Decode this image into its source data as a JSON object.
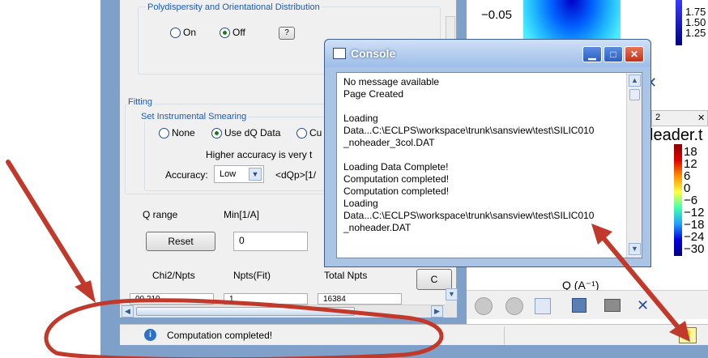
{
  "polydispersity": {
    "title": "Polydispersity and Orientational Distribution",
    "on_label": "On",
    "off_label": "Off",
    "help_label": "?"
  },
  "fitting": {
    "title": "Fitting",
    "smearing_title": "Set Instrumental Smearing",
    "options": [
      "None",
      "Use dQ Data",
      "Cu"
    ],
    "selected": "Use dQ Data",
    "accuracy_note": "Higher accuracy is very t",
    "accuracy_label": "Accuracy:",
    "accuracy_value": "Low",
    "dqp_label": "<dQp>[1/"
  },
  "qrange": {
    "label": "Q range",
    "min_header": "Min[1/A]",
    "reset_label": "Reset",
    "min_value": "0"
  },
  "stats": {
    "chi2_label": "Chi2/Npts",
    "npts_fit_label": "Npts(Fit)",
    "total_npts_label": "Total Npts",
    "chi2_value": "00.210",
    "npts_fit_value": "1",
    "total_npts_value": "16384",
    "cut_button_label": "C"
  },
  "plot": {
    "top_tick": "−0.05",
    "colorbar_top": [
      "1.75",
      "1.50",
      "1.25"
    ],
    "tab_fragment": "2",
    "title_fragment": "leader.t",
    "colorbar_bottom": [
      "18",
      "12",
      "6",
      "0",
      "−6",
      "−12",
      "−18",
      "−24",
      "−30"
    ],
    "xaxis_label": "Q (A⁻¹)"
  },
  "console": {
    "title": "Console",
    "lines": [
      "No message available",
      "Page Created",
      "",
      "Loading",
      "Data...C:\\ECLPS\\workspace\\trunk\\sansview\\test\\SILIC010",
      "_noheader_3col.DAT",
      "",
      "Loading Data Complete!",
      "Computation  completed!",
      "Computation  completed!",
      "Loading",
      "Data...C:\\ECLPS\\workspace\\trunk\\sansview\\test\\SILIC010",
      "_noheader.DAT"
    ]
  },
  "statusbar": {
    "message": "Computation  completed!"
  },
  "colors": {
    "annotation": "#c0392b",
    "window_frame": "#7ea0c9",
    "group_title": "#1e5ab4"
  }
}
